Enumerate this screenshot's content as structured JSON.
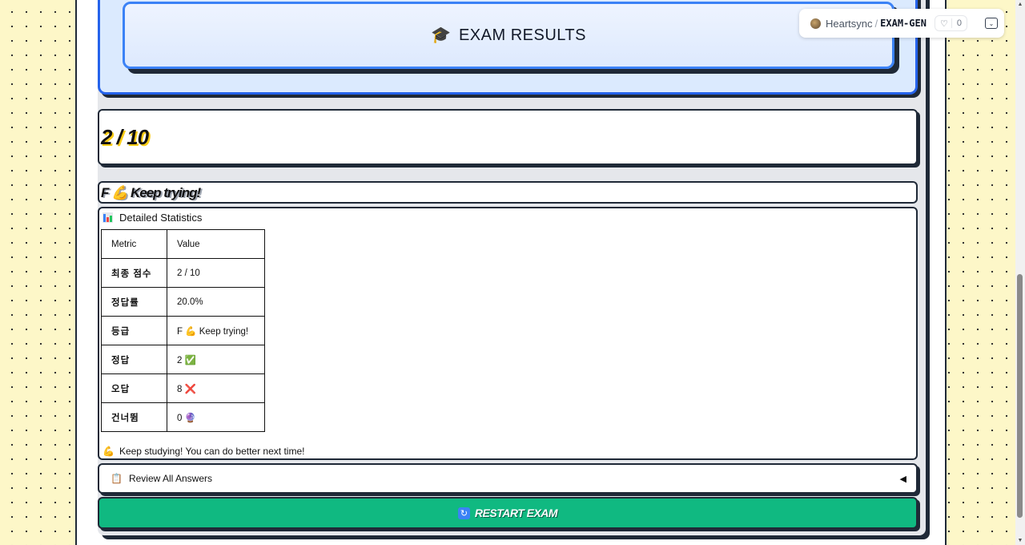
{
  "header": {
    "title": "EXAM RESULTS",
    "icon": "graduation-cap-icon"
  },
  "score": {
    "text": "2 / 10"
  },
  "grade": {
    "text": "F 💪 Keep trying!"
  },
  "stats": {
    "title": "Detailed Statistics",
    "columns": [
      "Metric",
      "Value"
    ],
    "rows": [
      {
        "metric": "최종 점수",
        "value": "2 / 10"
      },
      {
        "metric": "정답률",
        "value": "20.0%"
      },
      {
        "metric": "등급",
        "value": "F 💪 Keep trying!"
      },
      {
        "metric": "정답",
        "value": "2 ✅"
      },
      {
        "metric": "오답",
        "value": "8 ❌"
      },
      {
        "metric": "건너뜀",
        "value": "0 🔮"
      }
    ],
    "message": "Keep studying! You can do better next time!"
  },
  "review": {
    "label": "Review All Answers"
  },
  "restart": {
    "label": "RESTART EXAM"
  },
  "badge": {
    "owner": "Heartsync",
    "repo": "EXAM-GEN",
    "likes": "0"
  },
  "colors": {
    "accent_blue": "#3b82f6",
    "button_green": "#10b981",
    "page_bg": "#fdf7c8"
  }
}
